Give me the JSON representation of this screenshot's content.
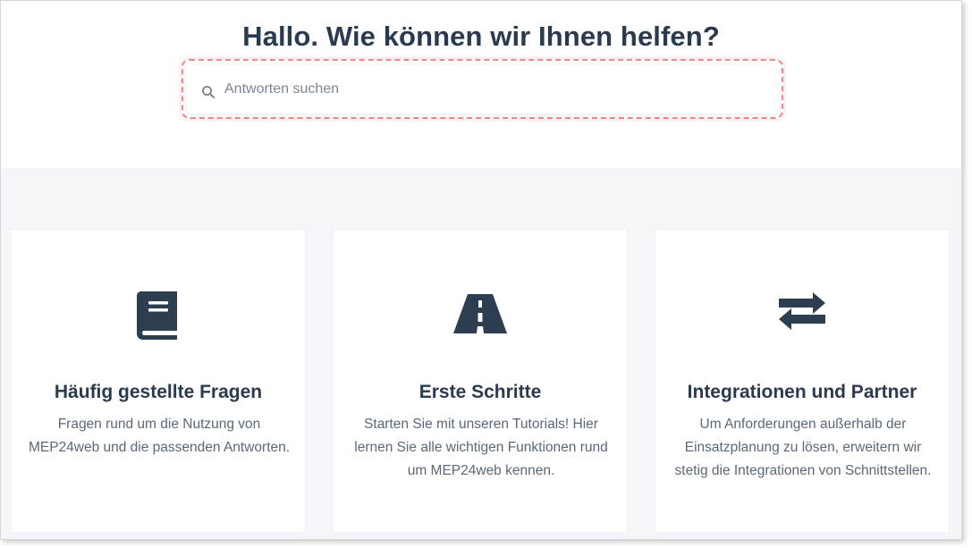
{
  "hero": {
    "title": "Hallo. Wie können wir Ihnen helfen?"
  },
  "search": {
    "placeholder": "Antworten suchen",
    "value": "",
    "icon": "search-icon"
  },
  "cards": [
    {
      "icon": "book-icon",
      "title": "Häufig gestellte Fragen",
      "description": "Fragen rund um die Nutzung von MEP24web und die passenden Antworten."
    },
    {
      "icon": "road-icon",
      "title": "Erste Schritte",
      "description": "Starten Sie mit unseren Tutorials! Hier lernen Sie alle wichtigen Funktionen rund um MEP24web kennen."
    },
    {
      "icon": "exchange-arrows-icon",
      "title": "Integrationen und Partner",
      "description": "Um Anforderungen außerhalb der Einsatzplanung zu lösen, erweitern wir stetig die Integrationen von Schnittstellen."
    }
  ],
  "colors": {
    "heading": "#2a3a4f",
    "body_text": "#5a6878",
    "icon": "#2c3e50",
    "section_background": "#f5f6fa",
    "highlight": "#ec8a84"
  }
}
